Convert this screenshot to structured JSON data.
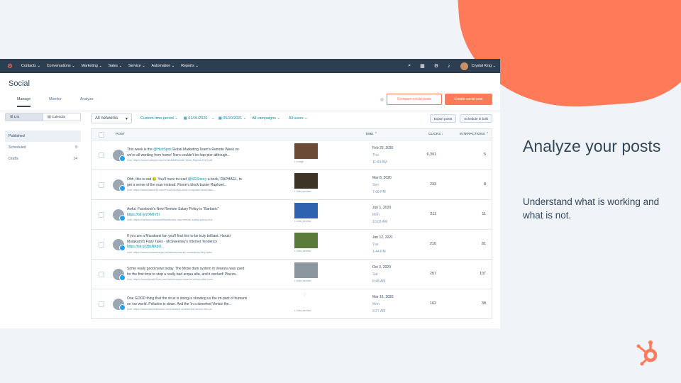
{
  "nav": {
    "items": [
      "Contacts ⌄",
      "Conversations ⌄",
      "Marketing ⌄",
      "Sales ⌄",
      "Service ⌄",
      "Automation ⌄",
      "Reports ⌄"
    ],
    "user": "Crystal King ⌄"
  },
  "page": {
    "title": "Social",
    "tabs": [
      "Manage",
      "Monitor",
      "Analyze"
    ],
    "compare_btn": "Compare social posts",
    "create_btn": "Create social post"
  },
  "sidebar": {
    "view_list": "List",
    "view_calendar": "Calendar",
    "items": [
      {
        "label": "Published",
        "count": ""
      },
      {
        "label": "Scheduled",
        "count": "9"
      },
      {
        "label": "Drafts",
        "count": "14"
      }
    ]
  },
  "filters": {
    "networks": "All networks",
    "time_period": "Custom time period ⌄",
    "date_from": "01/01/2020",
    "arrow": "→",
    "date_to": "05/20/2021 ⌄",
    "campaign": "All campaigns ⌄",
    "users": "All users ⌄",
    "export": "Export posts",
    "schedule": "Schedule in bulk"
  },
  "table": {
    "headers": {
      "post": "POST",
      "time": "TIME ⌃",
      "clicks": "CLICKS ↓",
      "interactions": "INTERACTIONS ⌃"
    },
    "rows": [
      {
        "text": "This week is the ",
        "mention": "@HubSpot",
        "text2": " Global Marketing Team's Remote Week so we're all working from home! Nero couldn't be hap-pier although...",
        "link": "",
        "url": "Link: https://www.hubspot.com/hubfs/55/Remote-Work-Report-2019.pdf",
        "thumb_label": "Image",
        "date": "Feb 20, 2020",
        "day": "Thu",
        "clock": "11:54 AM",
        "clicks": "6,391",
        "interactions": "5",
        "thumb_color": "#6b4b35"
      },
      {
        "text": "Ohh, this is sad 😢 You'll have to read ",
        "mention": "@SGStorey",
        "text2": " a book, RAPHAEL, to get a sense of the man instead. Rome's block-buster Raphael...",
        "link": "",
        "url": "Link: https://www.france24.com/en/20200306-rome-s-raphael-show-falls...",
        "thumb_label": "Link preview",
        "date": "Mar 8, 2020",
        "day": "Sun",
        "clock": "7:08 PM",
        "clicks": "233",
        "interactions": "8",
        "thumb_color": "#3d3428"
      },
      {
        "text": "Awful. Facebook's New Remote Salary Policy is \"Barbaric\"",
        "mention": "",
        "text2": "",
        "link": "https://bit.ly/2XMIV5I",
        "url": "Link: https://medium.com/swlh/facebooks-new-remote-salary-policy-is-b...",
        "thumb_label": "Link preview",
        "date": "Jun 1, 2020",
        "day": "Mon",
        "clock": "10:03 AM",
        "clicks": "211",
        "interactions": "11",
        "thumb_color": "#2f62b0"
      },
      {
        "text": "If you are a Murakami fan you'll find this to be truly brilliant. Haruki Murakami's Fairy Tales - McSweeney's Internet Tendency",
        "mention": "",
        "text2": "",
        "link": "https://bit.ly/3bsNKdU...",
        "url": "Link: https://www.mcsweeneys.net/articles/haruki-murakamis-fairy-tales",
        "thumb_label": "Link preview",
        "date": "Jan 12, 2021",
        "day": "Tue",
        "clock": "1:44 PM",
        "clicks": "210",
        "interactions": "81",
        "thumb_color": "#5a7a3a"
      },
      {
        "text": "Some really good news today. The Mose dam system in Venezia was used for the first time to stop a really bad acqua alta, and it worked! Piazza...",
        "mention": "",
        "text2": "",
        "link": "",
        "url": "Link: https://www.ilpost24ore.com/old/venezia-mose-la-prima-volta-comi...",
        "thumb_label": "Link preview",
        "date": "Oct 3, 2020",
        "day": "Sat",
        "clock": "8:48 AM",
        "clicks": "207",
        "interactions": "107",
        "thumb_color": "#8b969e"
      },
      {
        "text": "One GOOD thing that the virus is doing is showing us the im-pact of humans on our world. Pollution is down. And the 'in a deserted Venice the...",
        "mention": "",
        "text2": "",
        "link": "",
        "url": "Link: https://www.wantedinrome.com/news/in-a-deserted-venice-the-ca...",
        "thumb_label": "Link preview",
        "date": "Mar 16, 2020",
        "day": "Mon",
        "clock": "9:27 AM",
        "clicks": "162",
        "interactions": "38",
        "thumb_color": ""
      }
    ]
  },
  "right": {
    "title": "Analyze your posts",
    "desc": "Understand what is working and what is not."
  },
  "colors": {
    "accent": "#ff7a59",
    "nav": "#2d3e50",
    "link": "#0091ae"
  }
}
